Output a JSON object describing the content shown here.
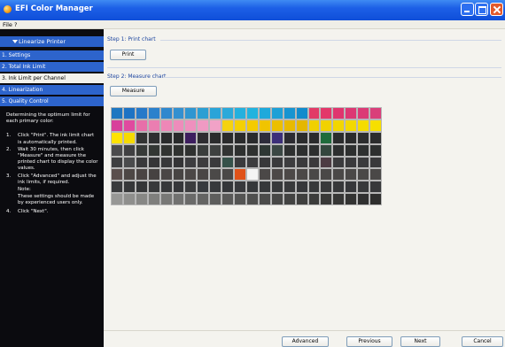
{
  "window": {
    "title": "EFI Color Manager"
  },
  "menu": {
    "items": [
      "File",
      "?"
    ]
  },
  "sidebar": {
    "section": "Linearize Printer",
    "items": [
      {
        "label": "1. Settings"
      },
      {
        "label": "2. Total Ink Limit"
      },
      {
        "label": "3. Ink Limit per Channel"
      },
      {
        "label": "4. Linearization"
      },
      {
        "label": "5. Quality Control"
      }
    ],
    "help": {
      "intro": "Determining the optimum limit for each primary color:",
      "steps": [
        {
          "n": "1.",
          "text": "Click \"Print\". The ink limit chart is automatically printed."
        },
        {
          "n": "2.",
          "text": "Wait 30 minutes, then click \"Measure\" and measure the printed chart to display the color values."
        },
        {
          "n": "3.",
          "text": "Click \"Advanced\" and adjust the ink limits, if required."
        },
        {
          "n": "",
          "text": "Note:"
        },
        {
          "n": "",
          "text": "These settings should be made by experienced users only."
        },
        {
          "n": "4.",
          "text": "Click \"Next\"."
        }
      ]
    }
  },
  "main": {
    "step1": {
      "title": "Step 1: Print chart",
      "button": "Print"
    },
    "step2": {
      "title": "Step 2: Measure chart",
      "button": "Measure"
    }
  },
  "footer": {
    "advanced": "Advanced",
    "previous": "Previous",
    "next": "Next",
    "cancel": "Cancel"
  },
  "chart_patches": [
    [
      "#1f77c1",
      "#1e73c4",
      "#2679c9",
      "#2b81cc",
      "#2f88ce",
      "#3390d0",
      "#2f96d1",
      "#2b9fd3",
      "#2aa4d8",
      "#2ba9da",
      "#24b0de",
      "#21b3df",
      "#1ea9db",
      "#1ea0d6",
      "#1794d1",
      "#118bcc",
      "#e23a67",
      "#e3376a",
      "#e0356e",
      "#dd3873",
      "#db3b76",
      "#d93f7a"
    ],
    [
      "#d8409b",
      "#e04a9f",
      "#e76fa9",
      "#eb7eb1",
      "#ee87b7",
      "#ee8cbb",
      "#ef90be",
      "#f09ac3",
      "#f1a2c7",
      "#f5d20f",
      "#f4d004",
      "#f4cb00",
      "#f0c400",
      "#ecbf00",
      "#e8ba00",
      "#e4b700",
      "#f0d000",
      "#f1d200",
      "#f2d600",
      "#f3d900",
      "#f5dc00",
      "#f6df00"
    ],
    [
      "#ffe200",
      "#f6da00",
      "#333433",
      "#2e2f30",
      "#2a2b2c",
      "#292a2b",
      "#3d1e5f",
      "#2e2d31",
      "#2b2c2d",
      "#2a2b2c",
      "#2a2b2c",
      "#2a2b2d",
      "#2d2c3b",
      "#3c2f79",
      "#2c2b31",
      "#2b2c2d",
      "#2a2b2c",
      "#1f6b3b",
      "#2b2c2d",
      "#2a2b2c",
      "#2c2d2e",
      "#2b2c2d"
    ],
    [
      "#4b4b4d",
      "#404042",
      "#373a38",
      "#333734",
      "#313331",
      "#303230",
      "#2f3130",
      "#3a3d3c",
      "#3e4140",
      "#323433",
      "#2e302f",
      "#2f3130",
      "#2e3734",
      "#3b4744",
      "#2e3030",
      "#2d2f2f",
      "#2d2f2f",
      "#34463d",
      "#2d2f2f",
      "#2d2f2f",
      "#2e3030",
      "#2d2f2f"
    ],
    [
      "#3e3f41",
      "#4a4b4d",
      "#39393b",
      "#353537",
      "#38383a",
      "#343436",
      "#3d3d40",
      "#3d3c3e",
      "#3a3a3c",
      "#36524a",
      "#3a3a3c",
      "#3c3c3e",
      "#38383a",
      "#3a3a3c",
      "#3d3d3f",
      "#3a3a3c",
      "#3b3a3c",
      "#4d3c43",
      "#3b3b3d",
      "#3a3a3c",
      "#3a3a3c",
      "#39393b"
    ],
    [
      "#5a4f4d",
      "#4d4745",
      "#4a4443",
      "#464241",
      "#4a4646",
      "#474443",
      "#4b4746",
      "#4a4645",
      "#4b4948",
      "#4a4847",
      "#e05219",
      "#f4f4f4",
      "#4b4847",
      "#4c4847",
      "#4c4847",
      "#4b4847",
      "#4a4847",
      "#4a4847",
      "#4a4847",
      "#4a4847",
      "#4a4847",
      "#4a4847"
    ],
    [
      "#3a3b3d",
      "#363739",
      "#353638",
      "#38393b",
      "#37383a",
      "#36373a",
      "#3b3c3e",
      "#373a3e",
      "#37393c",
      "#35373a",
      "#38393c",
      "#36383a",
      "#36383a",
      "#37393b",
      "#38393b",
      "#36373a",
      "#37383a",
      "#38393b",
      "#37383a",
      "#36373a",
      "#38393b",
      "#37383a"
    ],
    [
      "#979795",
      "#8f8f8d",
      "#878785",
      "#7f7f7d",
      "#787876",
      "#717170",
      "#6a6a69",
      "#646463",
      "#5e5e5d",
      "#595958",
      "#545453",
      "#4f4f4e",
      "#4b4b4a",
      "#474746",
      "#434342",
      "#3f3f3e",
      "#3c3c3b",
      "#393938",
      "#363635",
      "#333332",
      "#303030",
      "#2e2e2d"
    ]
  ]
}
